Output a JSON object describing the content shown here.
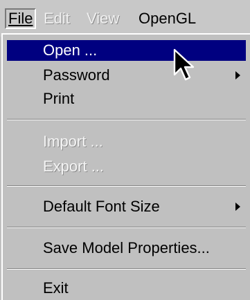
{
  "menubar": {
    "file": "File",
    "edit": "Edit",
    "view": "View",
    "opengl": "OpenGL"
  },
  "file_menu": {
    "open": "Open ...",
    "password": "Password",
    "print": "Print",
    "import": "Import ...",
    "export": "Export ...",
    "default_font_size": "Default Font Size",
    "save_model_properties": "Save Model Properties...",
    "exit": "Exit"
  },
  "colors": {
    "menu_background": "#c0c0c0",
    "highlight": "#000080",
    "highlight_text": "#ffffff"
  },
  "icons": {
    "cursor": "mouse-pointer-icon",
    "submenu": "submenu-arrow-icon"
  }
}
